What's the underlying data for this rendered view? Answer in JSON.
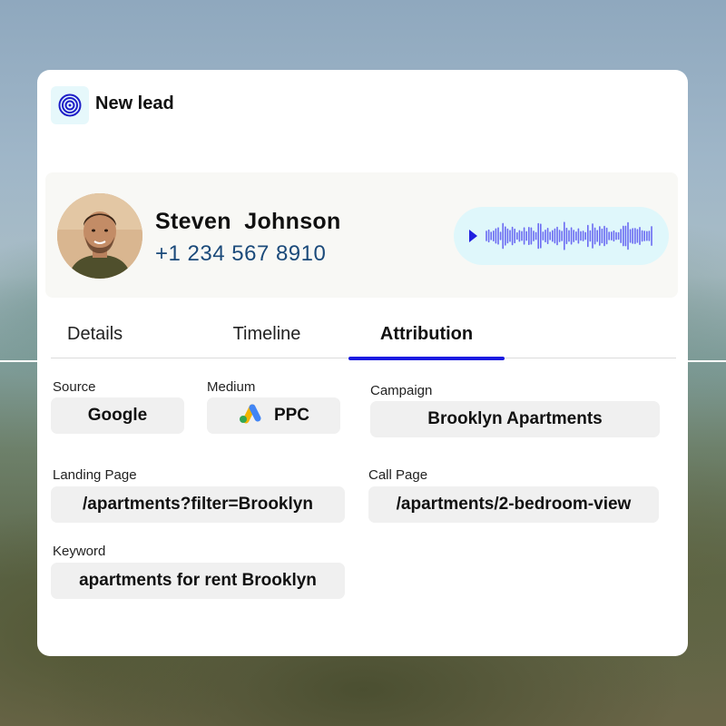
{
  "header": {
    "title": "New lead",
    "icon": "target-icon"
  },
  "contact": {
    "name": "Steven  Johnson",
    "phone": "+1 234 567 8910",
    "audio_icon": "play-icon",
    "audio_color": "#3333ee"
  },
  "tabs": [
    {
      "label": "Details",
      "active": false
    },
    {
      "label": "Timeline",
      "active": false
    },
    {
      "label": "Attribution",
      "active": true
    }
  ],
  "attribution": {
    "source": {
      "label": "Source",
      "value": "Google"
    },
    "medium": {
      "label": "Medium",
      "value": "PPC",
      "icon": "google-ads-icon"
    },
    "campaign": {
      "label": "Campaign",
      "value": "Brooklyn Apartments"
    },
    "landing_page": {
      "label": "Landing Page",
      "value": "/apartments?filter=Brooklyn"
    },
    "call_page": {
      "label": "Call Page",
      "value": "/apartments/2-bedroom-view"
    },
    "keyword": {
      "label": "Keyword",
      "value": "apartments for rent Brooklyn"
    }
  },
  "colors": {
    "accent": "#1a1ae0",
    "phone": "#1b4a7a",
    "audio_bg": "#dff7fb"
  }
}
